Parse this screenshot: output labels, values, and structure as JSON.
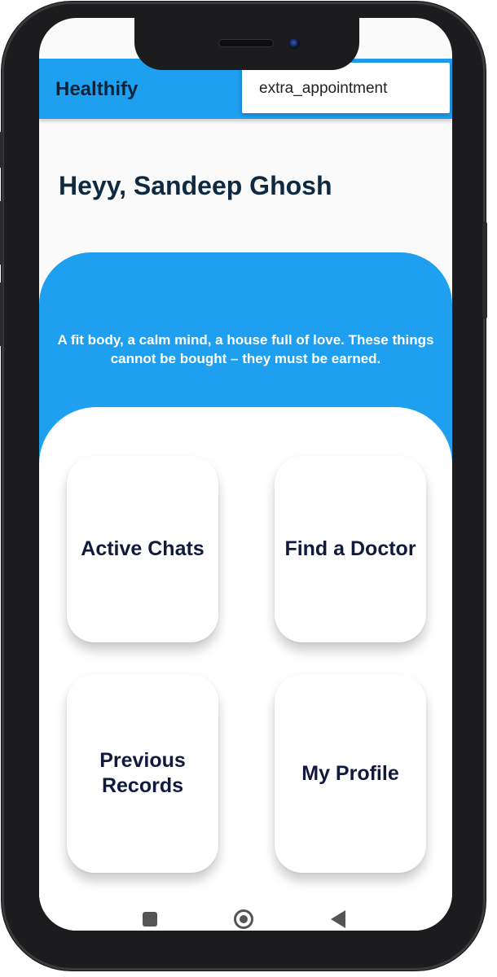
{
  "app": {
    "title": "Healthify",
    "accent_color": "#1e9ff0"
  },
  "menu": {
    "items": [
      "extra_appointment"
    ]
  },
  "home": {
    "greeting": "Heyy, Sandeep Ghosh",
    "quote": "A fit body, a calm mind, a house full of love. These things cannot be bought – they must be earned."
  },
  "cards": [
    {
      "label": "Active Chats"
    },
    {
      "label": "Find a Doctor"
    },
    {
      "label": "Previous\nRecords"
    },
    {
      "label": "My Profile"
    }
  ],
  "system_nav": {
    "icons": [
      "recents-square-icon",
      "home-circle-icon",
      "back-triangle-icon"
    ]
  }
}
